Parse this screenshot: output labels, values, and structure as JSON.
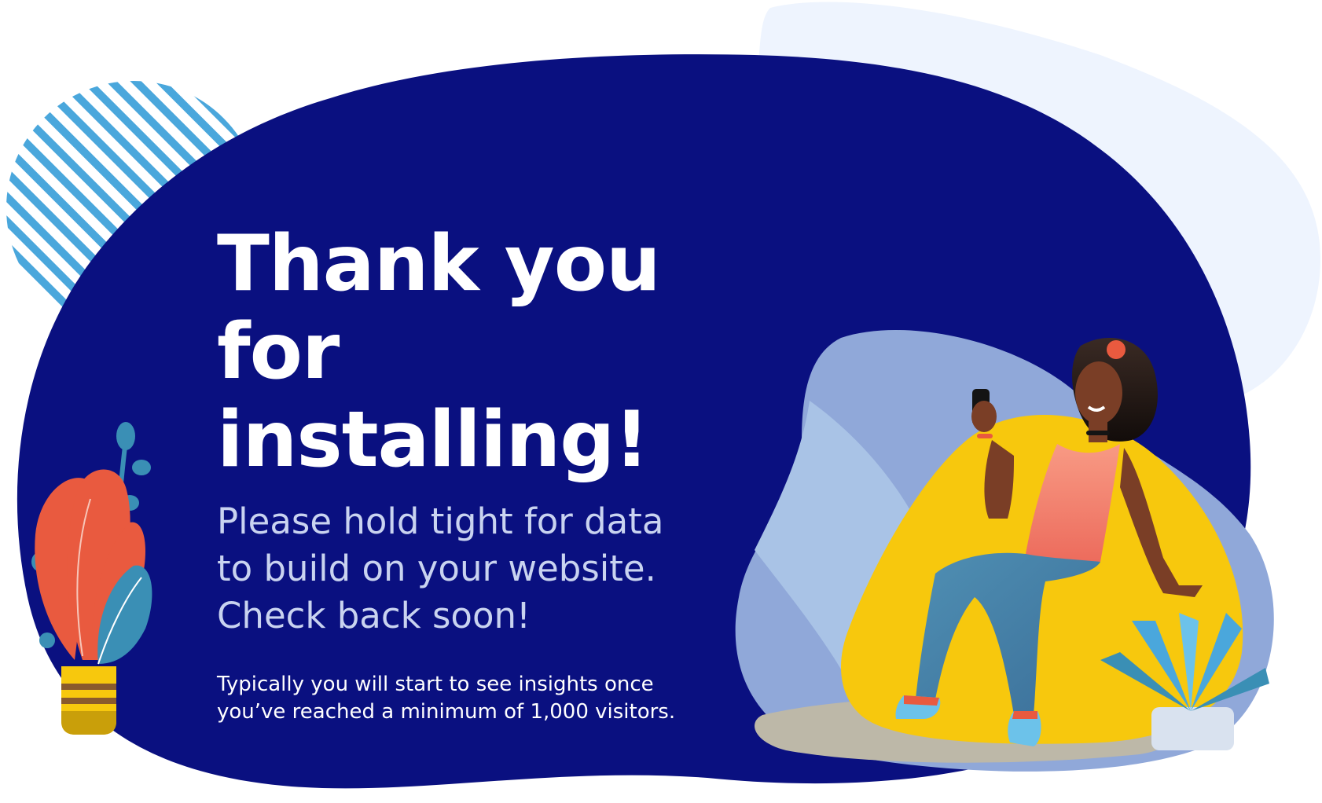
{
  "hero": {
    "headline_line1": "Thank you",
    "headline_line2": "for installing!",
    "sub_line1": "Please hold tight for data",
    "sub_line2": "to build on your website.",
    "sub_line3": "Check back soon!",
    "note_line1": "Typically you will start to see insights once",
    "note_line2": "you’ve reached a minimum of 1,000 visitors."
  },
  "colors": {
    "blob_navy": "#0a1080",
    "pale_blue": "#eef4fe",
    "stripe_blue": "#4aa7dc",
    "beanbag_yellow": "#f7c80d",
    "leaf_coral": "#e95a3f",
    "leaf_teal": "#3a8fb5"
  },
  "illustration": {
    "icons": [
      "plant-pot-icon",
      "woman-on-beanbag-icon",
      "smartphone-icon",
      "succulent-icon"
    ]
  }
}
